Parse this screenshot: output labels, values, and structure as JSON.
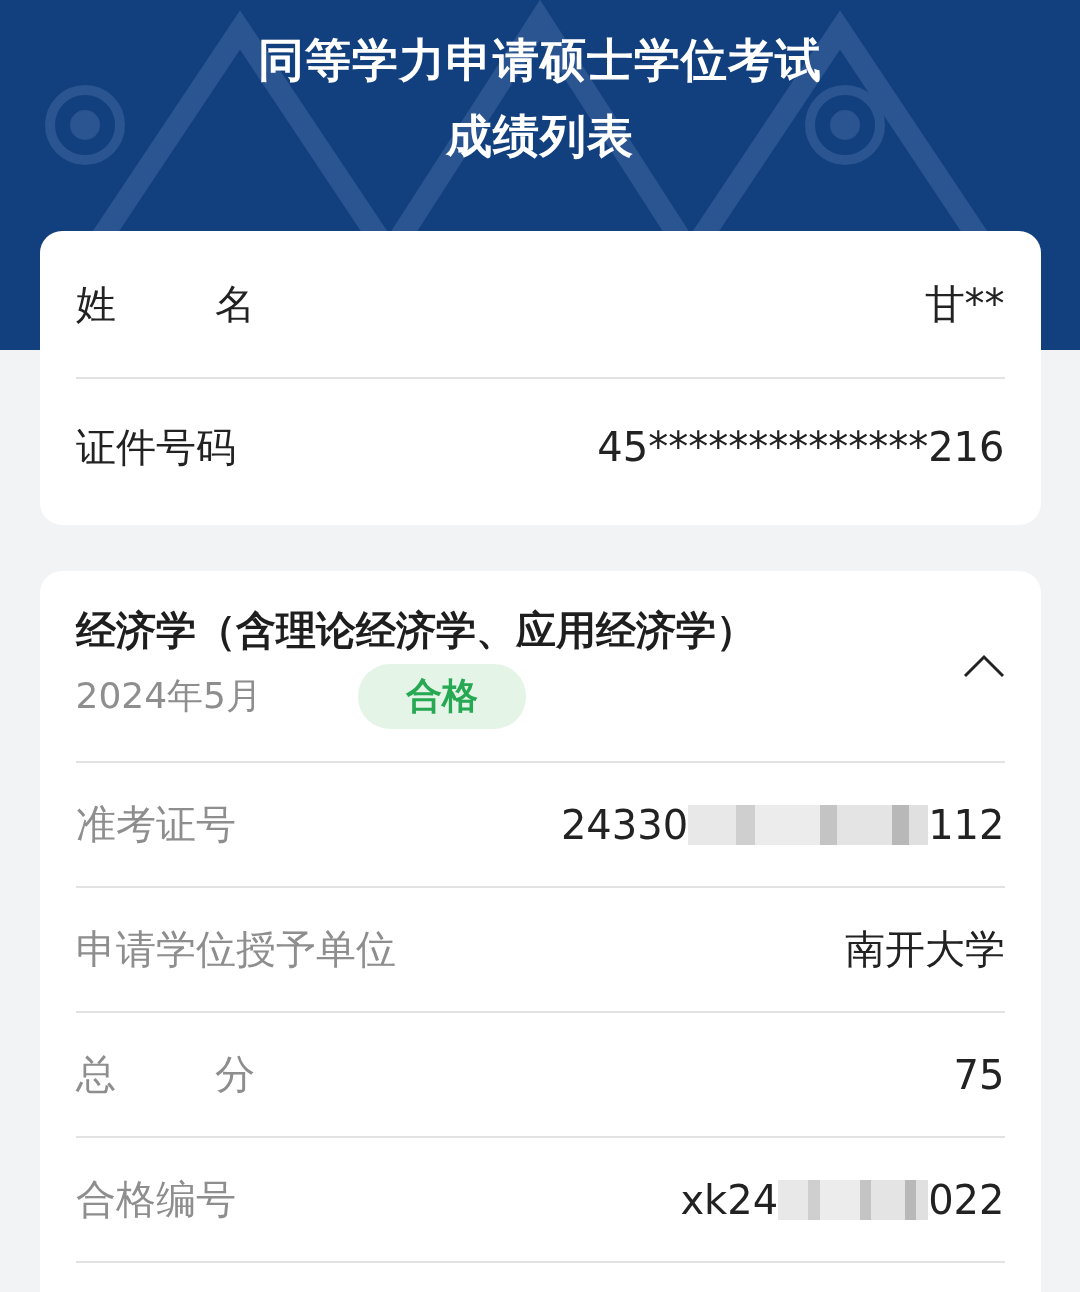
{
  "header": {
    "title_lines": [
      "同等学力申请硕士学位考试",
      "成绩列表"
    ]
  },
  "identity": [
    {
      "label": "姓 名",
      "spread": true,
      "value": "甘**"
    },
    {
      "label": "证件号码",
      "spread": false,
      "value": "45**************216"
    }
  ],
  "exam": {
    "subject": "经济学（含理论经济学、应用经济学）",
    "date": "2024年5月",
    "status": {
      "label": "合格",
      "kind": "pass"
    },
    "expanded": true,
    "rows": [
      {
        "label": "准考证号",
        "spread": false,
        "value_parts": [
          {
            "kind": "text",
            "text": "24330"
          },
          {
            "kind": "redaction"
          },
          {
            "kind": "text",
            "text": "112"
          }
        ]
      },
      {
        "label": "申请学位授予单位",
        "spread": false,
        "value_parts": [
          {
            "kind": "text",
            "text": "南开大学"
          }
        ]
      },
      {
        "label": "总 分",
        "spread": true,
        "value_parts": [
          {
            "kind": "text",
            "text": "75"
          }
        ]
      },
      {
        "label": "合格编号",
        "spread": false,
        "value_parts": [
          {
            "kind": "text",
            "text": "xk24"
          },
          {
            "kind": "redaction"
          },
          {
            "kind": "text",
            "text": "022"
          }
        ]
      }
    ]
  }
}
